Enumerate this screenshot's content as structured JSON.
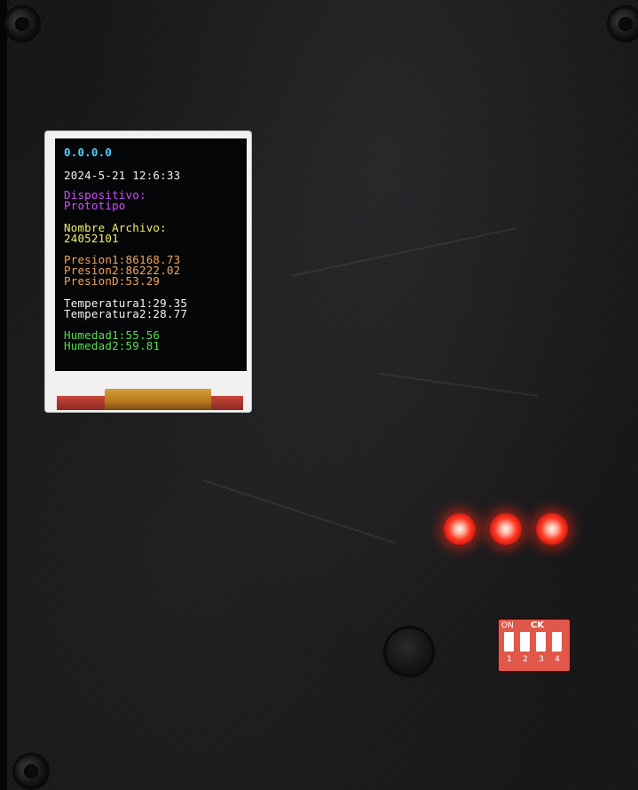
{
  "display": {
    "ip": "0.0.0.0",
    "datetime": "2024-5-21 12:6:33",
    "device_label": "Dispositivo:",
    "device_name": "Prototipo",
    "file_label": "Nombre Archivo:",
    "file_name": "24052101",
    "presion1": "Presion1:86168.73",
    "presion2": "Presion2:86222.02",
    "presionD": "PresionD:53.29",
    "temperatura1": "Temperatura1:29.35",
    "temperatura2": "Temperatura2:28.77",
    "humedad1": "Humedad1:55.56",
    "humedad2": "Humedad2:59.81"
  },
  "dip_switch": {
    "on_label": "ON",
    "brand_mark": "CK",
    "numbers": [
      "1",
      "2",
      "3",
      "4"
    ]
  },
  "leds": {
    "count": 3,
    "color": "#ff3a22"
  },
  "colors": {
    "ip": "#4fd0ff",
    "device": "#d050ff",
    "file": "#f2ef6a",
    "pressure": "#f0a45a",
    "temperature": "#f2f2f2",
    "humidity": "#52e04a"
  }
}
